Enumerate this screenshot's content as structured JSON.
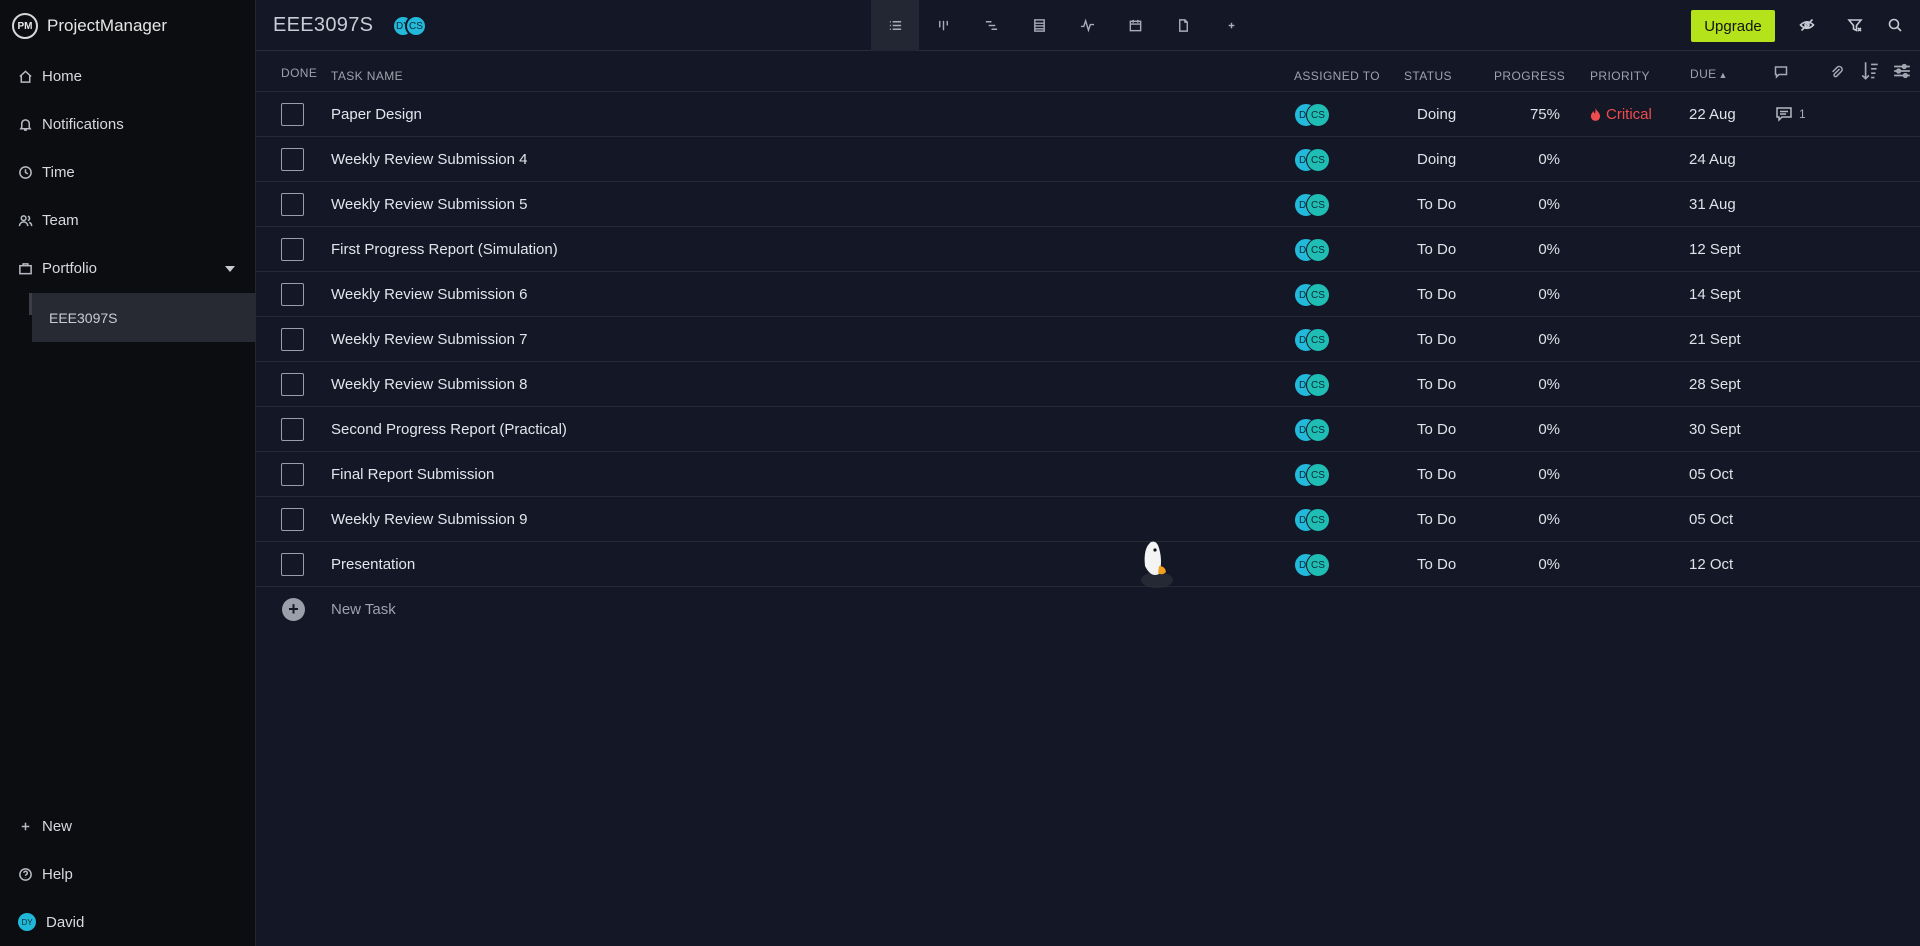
{
  "app": {
    "brand_logo": "PM",
    "brand_name": "ProjectManager"
  },
  "sidebar": {
    "items": [
      {
        "label": "Home",
        "icon": "home-icon"
      },
      {
        "label": "Notifications",
        "icon": "bell-icon"
      },
      {
        "label": "Time",
        "icon": "clock-icon"
      },
      {
        "label": "Team",
        "icon": "team-icon"
      },
      {
        "label": "Portfolio",
        "icon": "briefcase-icon"
      }
    ],
    "portfolio_child": "EEE3097S",
    "bottom": {
      "new_label": "New",
      "help_label": "Help",
      "user_initials": "DY",
      "user_name": "David"
    }
  },
  "header": {
    "project_title": "EEE3097S",
    "team_avatars": [
      "DY",
      "CS"
    ],
    "view_tabs": [
      "list-view",
      "board-view",
      "gantt-view",
      "sheet-view",
      "dashboard-view",
      "calendar-view",
      "files-view",
      "add-view"
    ],
    "upgrade_label": "Upgrade"
  },
  "table": {
    "columns": {
      "done": "DONE",
      "task_name": "TASK NAME",
      "assigned_to": "ASSIGNED TO",
      "status": "STATUS",
      "progress": "PROGRESS",
      "priority": "PRIORITY",
      "due": "DUE"
    },
    "rows": [
      {
        "name": "Paper Design",
        "assignees": [
          "DY",
          "CS"
        ],
        "status": "Doing",
        "progress": "75%",
        "priority": "Critical",
        "due": "22 Aug",
        "comments": "1"
      },
      {
        "name": "Weekly Review Submission 4",
        "assignees": [
          "DY",
          "CS"
        ],
        "status": "Doing",
        "progress": "0%",
        "priority": "",
        "due": "24 Aug",
        "comments": ""
      },
      {
        "name": "Weekly Review Submission 5",
        "assignees": [
          "DY",
          "CS"
        ],
        "status": "To Do",
        "progress": "0%",
        "priority": "",
        "due": "31 Aug",
        "comments": ""
      },
      {
        "name": "First Progress Report (Simulation)",
        "assignees": [
          "DY",
          "CS"
        ],
        "status": "To Do",
        "progress": "0%",
        "priority": "",
        "due": "12 Sept",
        "comments": ""
      },
      {
        "name": "Weekly Review Submission 6",
        "assignees": [
          "DY",
          "CS"
        ],
        "status": "To Do",
        "progress": "0%",
        "priority": "",
        "due": "14 Sept",
        "comments": ""
      },
      {
        "name": "Weekly Review Submission 7",
        "assignees": [
          "DY",
          "CS"
        ],
        "status": "To Do",
        "progress": "0%",
        "priority": "",
        "due": "21 Sept",
        "comments": ""
      },
      {
        "name": "Weekly Review Submission 8",
        "assignees": [
          "DY",
          "CS"
        ],
        "status": "To Do",
        "progress": "0%",
        "priority": "",
        "due": "28 Sept",
        "comments": ""
      },
      {
        "name": "Second Progress Report (Practical)",
        "assignees": [
          "DY",
          "CS"
        ],
        "status": "To Do",
        "progress": "0%",
        "priority": "",
        "due": "30 Sept",
        "comments": ""
      },
      {
        "name": "Final Report Submission",
        "assignees": [
          "DY",
          "CS"
        ],
        "status": "To Do",
        "progress": "0%",
        "priority": "",
        "due": "05 Oct",
        "comments": ""
      },
      {
        "name": "Weekly Review Submission 9",
        "assignees": [
          "DY",
          "CS"
        ],
        "status": "To Do",
        "progress": "0%",
        "priority": "",
        "due": "05 Oct",
        "comments": ""
      },
      {
        "name": "Presentation",
        "assignees": [
          "DY",
          "CS"
        ],
        "status": "To Do",
        "progress": "0%",
        "priority": "",
        "due": "12 Oct",
        "comments": ""
      }
    ],
    "new_task_label": "New Task"
  },
  "colors": {
    "background": "#131726",
    "sidebar": "#0c0d10",
    "accent": "#b4e21b",
    "avatar": "#22b9da",
    "critical": "#ef4d4d"
  }
}
